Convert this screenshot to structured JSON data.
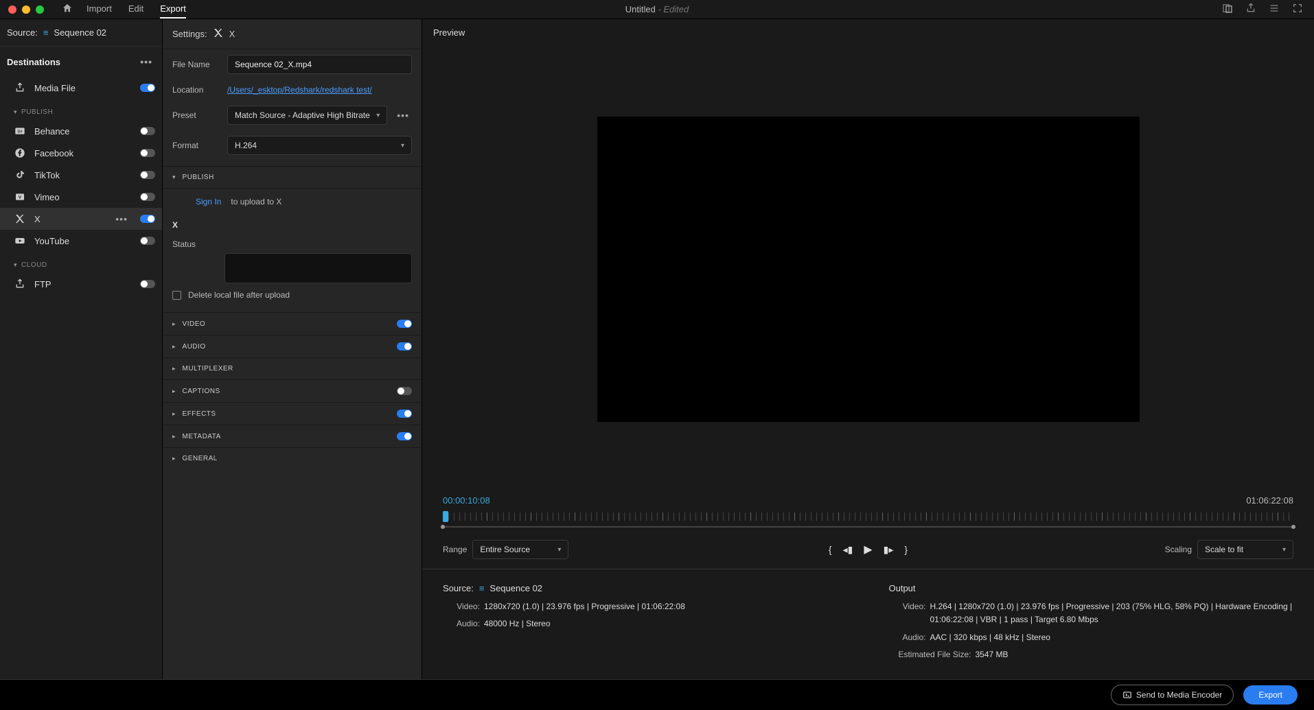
{
  "window": {
    "title": "Untitled",
    "status": "Edited"
  },
  "topTabs": {
    "import": "Import",
    "edit": "Edit",
    "export": "Export"
  },
  "source": {
    "label": "Source:",
    "name": "Sequence 02"
  },
  "destinations": {
    "header": "Destinations",
    "mediaFile": "Media File",
    "publishLabel": "PUBLISH",
    "cloudLabel": "CLOUD",
    "items": [
      {
        "label": "Behance",
        "on": false
      },
      {
        "label": "Facebook",
        "on": false
      },
      {
        "label": "TikTok",
        "on": false
      },
      {
        "label": "Vimeo",
        "on": false
      },
      {
        "label": "X",
        "on": true,
        "selected": true
      },
      {
        "label": "YouTube",
        "on": false
      }
    ],
    "ftp": "FTP"
  },
  "settings": {
    "header": "Settings:",
    "platform": "X",
    "fileNameLabel": "File Name",
    "fileName": "Sequence 02_X.mp4",
    "locationLabel": "Location",
    "location": "/Users/_esktop/Redshark/redshark test/",
    "presetLabel": "Preset",
    "preset": "Match Source - Adaptive High Bitrate",
    "formatLabel": "Format",
    "format": "H.264",
    "publish": {
      "header": "PUBLISH",
      "signIn": "Sign In",
      "signInSuffix": "to upload to X",
      "serviceLabel": "X",
      "statusLabel": "Status",
      "deleteLocal": "Delete local file after upload"
    },
    "accordions": [
      {
        "label": "VIDEO",
        "on": true
      },
      {
        "label": "AUDIO",
        "on": true
      },
      {
        "label": "MULTIPLEXER",
        "on": null
      },
      {
        "label": "CAPTIONS",
        "on": false
      },
      {
        "label": "EFFECTS",
        "on": true
      },
      {
        "label": "METADATA",
        "on": true
      },
      {
        "label": "GENERAL",
        "on": null
      }
    ]
  },
  "preview": {
    "header": "Preview",
    "currentTC": "00:00:10:08",
    "durationTC": "01:06:22:08",
    "rangeLabel": "Range",
    "range": "Entire Source",
    "scalingLabel": "Scaling",
    "scaling": "Scale to fit"
  },
  "info": {
    "source": {
      "label": "Source:",
      "name": "Sequence 02",
      "videoLabel": "Video:",
      "video": "1280x720 (1.0)  |  23.976 fps  |  Progressive  |  01:06:22:08",
      "audioLabel": "Audio:",
      "audio": "48000 Hz  |  Stereo"
    },
    "output": {
      "label": "Output",
      "videoLabel": "Video:",
      "video": "H.264  |  1280x720 (1.0)  |  23.976 fps  |  Progressive  |  203 (75% HLG, 58% PQ)  |  Hardware Encoding  |  01:06:22:08  |  VBR  |  1 pass  |  Target 6.80 Mbps",
      "audioLabel": "Audio:",
      "audio": "AAC  |  320 kbps  |  48 kHz  |  Stereo",
      "estLabel": "Estimated File Size:",
      "est": "3547 MB"
    }
  },
  "footer": {
    "sendToEncoder": "Send to Media Encoder",
    "export": "Export"
  }
}
